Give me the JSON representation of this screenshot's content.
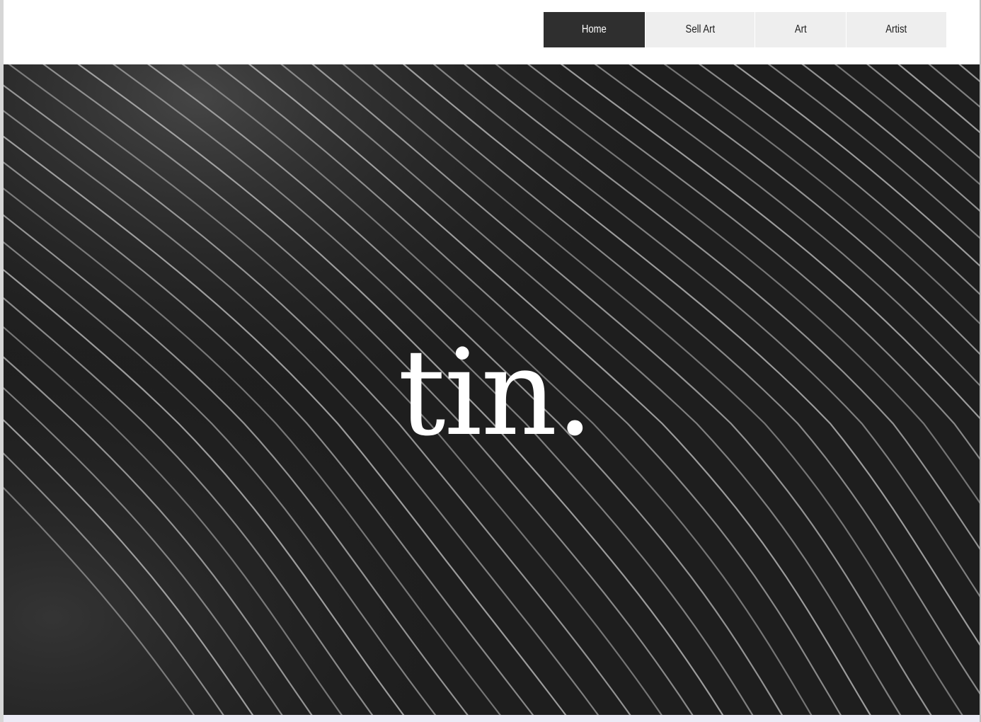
{
  "nav": {
    "items": [
      {
        "label": "Home",
        "active": true
      },
      {
        "label": "Sell Art",
        "active": false
      },
      {
        "label": "Art",
        "active": false
      },
      {
        "label": "Artist",
        "active": false
      }
    ]
  },
  "hero": {
    "title": "tin."
  },
  "colors": {
    "nav_active_bg": "#2f2f2f",
    "nav_bg": "#eeeeee",
    "hero_bg": "#1e1e1e",
    "line_color": "#bdbdbd"
  }
}
